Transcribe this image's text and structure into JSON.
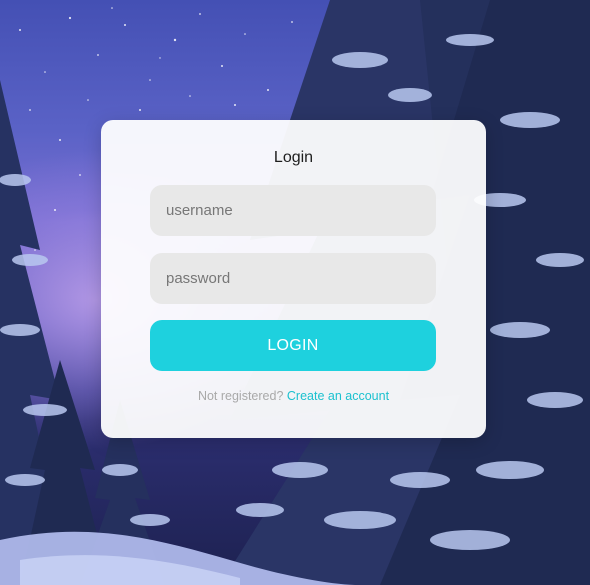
{
  "login": {
    "title": "Login",
    "username_placeholder": "username",
    "password_placeholder": "password",
    "button_label": "LOGIN",
    "register_prompt": "Not registered?",
    "register_link": "Create an account"
  },
  "colors": {
    "accent": "#1ed1de",
    "link": "#1cc1cf",
    "card": "#ffffff",
    "field": "#e8e8e8"
  }
}
